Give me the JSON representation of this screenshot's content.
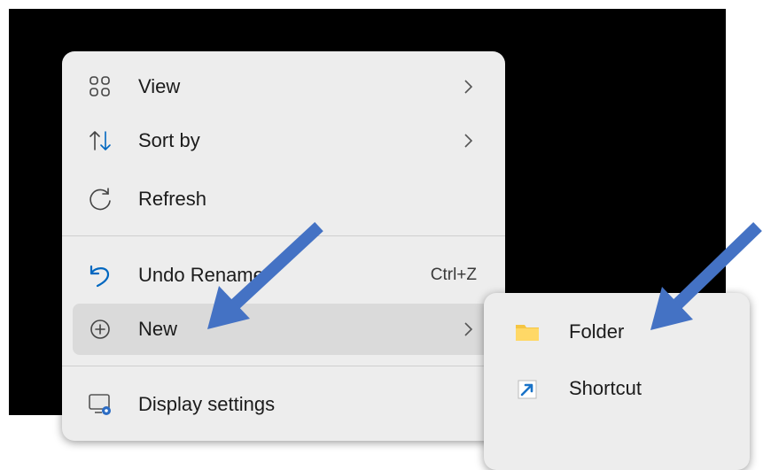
{
  "context_menu": {
    "items": [
      {
        "label": "View",
        "icon": "grid-icon",
        "has_submenu": true
      },
      {
        "label": "Sort by",
        "icon": "sort-arrows-icon",
        "has_submenu": true
      },
      {
        "label": "Refresh",
        "icon": "refresh-icon",
        "has_submenu": false
      },
      {
        "label": "Undo Rename",
        "icon": "undo-icon",
        "shortcut": "Ctrl+Z"
      },
      {
        "label": "New",
        "icon": "plus-circle-icon",
        "has_submenu": true,
        "hovered": true
      },
      {
        "label": "Display settings",
        "icon": "display-settings-icon",
        "has_submenu": false
      }
    ]
  },
  "new_submenu": {
    "items": [
      {
        "label": "Folder",
        "icon": "folder-icon"
      },
      {
        "label": "Shortcut",
        "icon": "shortcut-icon"
      }
    ]
  },
  "colors": {
    "menu_bg": "#ededed",
    "hover_bg": "#dadada",
    "accent": "#0067c0",
    "annotation_arrow": "#4472c4",
    "folder": "#f5c542"
  }
}
